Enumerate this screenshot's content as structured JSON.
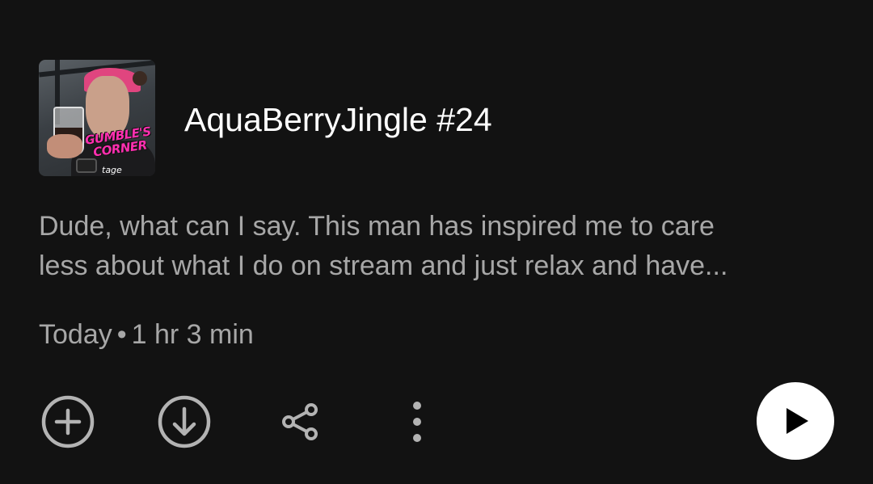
{
  "episode": {
    "title": "AquaBerryJingle #24",
    "description": "Dude, what can I say.  This man has inspired me to care\nless about what I do on stream and just relax and have...",
    "date": "Today",
    "separator": "•",
    "duration": "1 hr 3 min",
    "cover": {
      "logo_line1": "GUMBLE'S",
      "logo_line2": "CORNER",
      "logo_sub": "tage"
    }
  },
  "actions": {
    "add_icon": "add-circle-icon",
    "download_icon": "download-circle-icon",
    "share_icon": "share-icon",
    "more_icon": "more-vertical-icon",
    "play_icon": "play-icon"
  },
  "colors": {
    "background": "#121212",
    "title": "#ffffff",
    "secondary_text": "#a7a7a7",
    "icon": "#b3b3b3",
    "logo": "#ff2fb0"
  }
}
